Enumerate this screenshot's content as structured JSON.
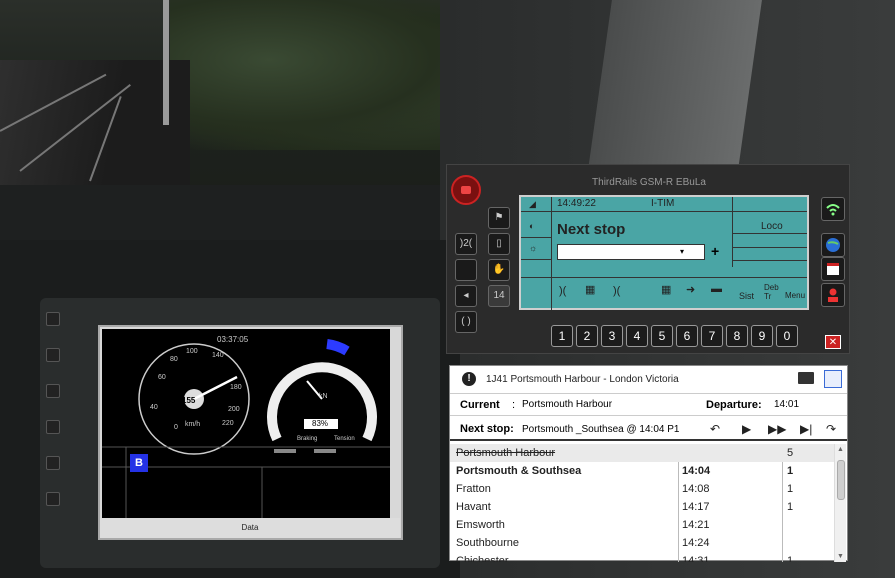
{
  "ebula": {
    "title": "ThirdRails GSM-R EBuLa",
    "screen": {
      "time": "14:49:22",
      "mode": "I-TIM",
      "loco": "Loco",
      "next_stop_label": "Next stop",
      "next_stop_plus": "+",
      "bottom_labels": [
        "Sist",
        "Deb Tr",
        "Menu"
      ]
    },
    "side_buttons": [
      "14"
    ],
    "number_keys": [
      "1",
      "2",
      "3",
      "4",
      "5",
      "6",
      "7",
      "8",
      "9",
      "0"
    ]
  },
  "dmi": {
    "clock": "03:37:05",
    "b_label": "B",
    "bottom_label": "Data",
    "speed_unit": "km/h",
    "speed_value": "155",
    "pressure_unit": "kN",
    "pressure_value": "83%",
    "braking_label": "Braking",
    "tension_label": "Tension"
  },
  "timetable": {
    "train": "1J41 Portsmouth Harbour - London Victoria",
    "current_label": "Current",
    "current_value": "Portsmouth Harbour",
    "departure_label": "Departure:",
    "departure_value": "14:01",
    "next_stop_label": "Next stop:",
    "next_stop_value": "Portsmouth _Southsea @ 14:04 P1",
    "stops": [
      {
        "station": "Portsmouth Harbour",
        "time": "",
        "platform": "5",
        "passed": true
      },
      {
        "station": "Portsmouth & Southsea",
        "time": "14:04",
        "platform": "1",
        "bold": true
      },
      {
        "station": "Fratton",
        "time": "14:08",
        "platform": "1"
      },
      {
        "station": "Havant",
        "time": "14:17",
        "platform": "1"
      },
      {
        "station": "Emsworth",
        "time": "14:21",
        "platform": ""
      },
      {
        "station": "Southbourne",
        "time": "14:24",
        "platform": ""
      },
      {
        "station": "Chichester",
        "time": "14:31",
        "platform": "1"
      }
    ]
  }
}
